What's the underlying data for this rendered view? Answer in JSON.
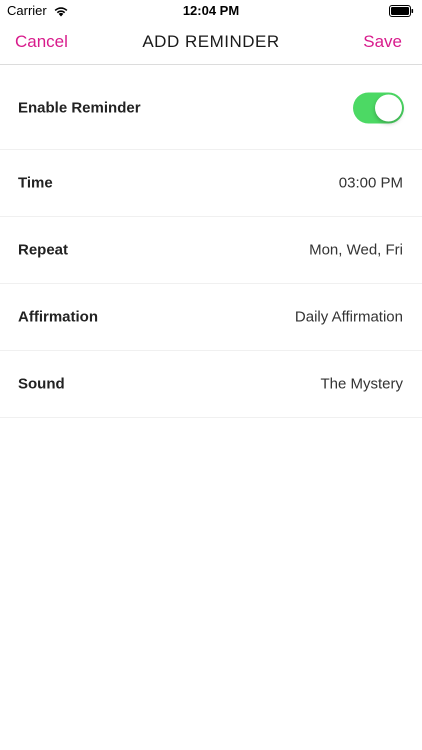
{
  "status_bar": {
    "carrier": "Carrier",
    "time": "12:04 PM",
    "wifi_icon": "wifi-icon",
    "battery_icon": "battery-icon"
  },
  "nav": {
    "cancel": "Cancel",
    "title": "ADD REMINDER",
    "save": "Save",
    "accent_color": "#d81b8c"
  },
  "settings": {
    "enable_reminder": {
      "label": "Enable Reminder",
      "enabled": true,
      "toggle_color": "#4cd964"
    },
    "time": {
      "label": "Time",
      "value": "03:00 PM"
    },
    "repeat": {
      "label": "Repeat",
      "value": "Mon, Wed, Fri"
    },
    "affirmation": {
      "label": "Affirmation",
      "value": "Daily Affirmation"
    },
    "sound": {
      "label": "Sound",
      "value": "The Mystery"
    }
  }
}
